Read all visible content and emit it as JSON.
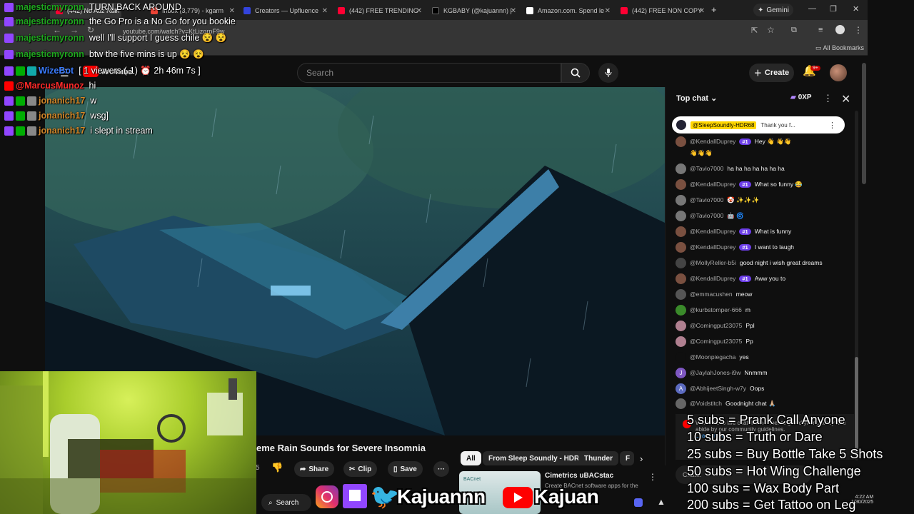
{
  "browser": {
    "tabs": [
      {
        "label": "(442) No Adz Rain",
        "color": "#ff0033"
      },
      {
        "label": "Inbox (3,779) - kgarm",
        "color": "#ea4335"
      },
      {
        "label": "Creators — Upfluence",
        "color": "#3344dd"
      },
      {
        "label": "(442) FREE TRENDING",
        "color": "#ff0033"
      },
      {
        "label": "KGBABY (@kajuannn) |",
        "color": "#000000"
      },
      {
        "label": "Amazon.com. Spend le",
        "color": "#ffffff"
      },
      {
        "label": "(442) FREE NON COPY",
        "color": "#ff0033"
      }
    ],
    "new_tab": "+",
    "gemini": "Gemini",
    "url": "youtube.com/watch?v=KtLizqrpF9w",
    "all_bookmarks": "All Bookmarks"
  },
  "youtube": {
    "logo": "YouTube",
    "search_placeholder": "Search",
    "create_label": "Create",
    "notif_count": "9+",
    "video_title": "eme Rain Sounds for Severe Insomnia",
    "actions": {
      "share": "Share",
      "clip": "Clip",
      "save": "Save",
      "more": "···"
    },
    "chips": [
      "All",
      "From Sleep Soundly - HDR",
      "Thunder",
      "F"
    ],
    "rec": {
      "title": "Cimetrics uBACstac",
      "subtitle": "Create BACnet software apps for the",
      "thumb_label": "BACnet"
    },
    "bottom_search": "Search"
  },
  "chat": {
    "header": "Top chat",
    "xp": "0XP",
    "pinned_user": "@SleepSoundly-HDR68",
    "pinned_text": "Thank you f...",
    "messages": [
      {
        "author": "@KendallDuprey",
        "badge": "#1",
        "text": "Hey 👋 👋👋",
        "avatar": "#7a5040"
      },
      {
        "author": "",
        "badge": "",
        "text": "👋👋👋",
        "avatar": ""
      },
      {
        "author": "@Tavio7000",
        "badge": "",
        "text": "ha ha ha ha ha ha ha",
        "avatar": "#777"
      },
      {
        "author": "@KendallDuprey",
        "badge": "#1",
        "text": "What so funny 😂",
        "avatar": "#7a5040"
      },
      {
        "author": "@Tavio7000",
        "badge": "",
        "text": "🤡 ✨✨✨",
        "avatar": "#777"
      },
      {
        "author": "@Tavio7000",
        "badge": "",
        "text": "🤖 🌀",
        "avatar": "#777"
      },
      {
        "author": "@KendallDuprey",
        "badge": "#1",
        "text": "What is funny",
        "avatar": "#7a5040"
      },
      {
        "author": "@KendallDuprey",
        "badge": "#1",
        "text": "I want to laugh",
        "avatar": "#7a5040"
      },
      {
        "author": "@MollyReller-b5i",
        "badge": "",
        "text": "good night i wish great dreams",
        "avatar": "#444"
      },
      {
        "author": "@KendallDuprey",
        "badge": "#1",
        "text": "Aww you to",
        "avatar": "#7a5040"
      },
      {
        "author": "@emmacushen",
        "badge": "",
        "text": "meow",
        "avatar": "#555"
      },
      {
        "author": "@kurbstomper-666",
        "badge": "",
        "text": "m",
        "avatar": "#3a8a2a"
      },
      {
        "author": "@Comingput23075",
        "badge": "",
        "text": "Ppl",
        "avatar": "#b08090"
      },
      {
        "author": "@Comingput23075",
        "badge": "",
        "text": "Pp",
        "avatar": "#b08090"
      },
      {
        "author": "@Moonpiegacha",
        "badge": "",
        "text": "yes",
        "avatar": "#0f0f0f"
      },
      {
        "author": "@JaylahJones-i9w",
        "badge": "",
        "text": "Nnmmm",
        "avatar": "#7e57c2"
      },
      {
        "author": "@AbhijeetSingh-w7y",
        "badge": "",
        "text": "Oops",
        "avatar": "#5c6bc0"
      },
      {
        "author": "@Voidstitch",
        "badge": "",
        "text": "Goodnight chat 🙏🏼",
        "avatar": "#666"
      }
    ],
    "avatar_letters": {
      "JaylahJones": "J",
      "AbhijeetSingh": "A"
    },
    "footer": "Welcome to live chat! Remember to guard your privacy and abide by our community guidelines.",
    "learn_more": "Learn more",
    "input_placeholder": "Chat..."
  },
  "overlay_chat": [
    {
      "user": "majesticmyronn",
      "color": "#1fa71f",
      "platform": "tw",
      "text": "TURN BACK AROUND"
    },
    {
      "user": "majesticmyronn",
      "color": "#1fa71f",
      "platform": "tw",
      "text": "the Go Pro is a No Go for you bookie"
    },
    {
      "user": "majesticmyronn",
      "color": "#1fa71f",
      "platform": "tw",
      "text": "well I'll support I guess chile 😵 😵"
    },
    {
      "user": "majesticmyronn",
      "color": "#1fa71f",
      "platform": "tw",
      "text": "btw the five mins is up 😵 😵"
    },
    {
      "user": "WizeBot",
      "color": "#3a7cff",
      "platform": "tw",
      "text": "[ 1 viewers (-1) ⏰ 2h 46m 7s ]"
    },
    {
      "user": "@MarcusMunoz",
      "color": "#ff2a2a",
      "platform": "yt",
      "text": "hi"
    },
    {
      "user": "jonanich17",
      "color": "#d2882a",
      "platform": "tw",
      "text": "w"
    },
    {
      "user": "jonanich17",
      "color": "#d2882a",
      "platform": "tw",
      "text": "wsg]"
    },
    {
      "user": "jonanich17",
      "color": "#d2882a",
      "platform": "tw",
      "text": "i slept in stream"
    }
  ],
  "goals": [
    "5 subs = Prank Call Anyone",
    "10 subs = Truth or Dare",
    "25 subs = Buy Bottle Take 5 Shots",
    "50 subs = Hot Wing Challenge",
    "100 subs = Wax Body Part",
    "200 subs = Get Tattoo on Leg"
  ],
  "socials": {
    "handle1": "Kajuannn",
    "handle2": "Kajuan"
  },
  "taskbar": {
    "time": "4:22 AM",
    "date": "1/30/2025"
  },
  "colors": {
    "twitch": "#9146ff",
    "youtube_red": "#ff0000",
    "webcam_green": "#b5d93a",
    "chat_badge": "#6c3ee8"
  }
}
